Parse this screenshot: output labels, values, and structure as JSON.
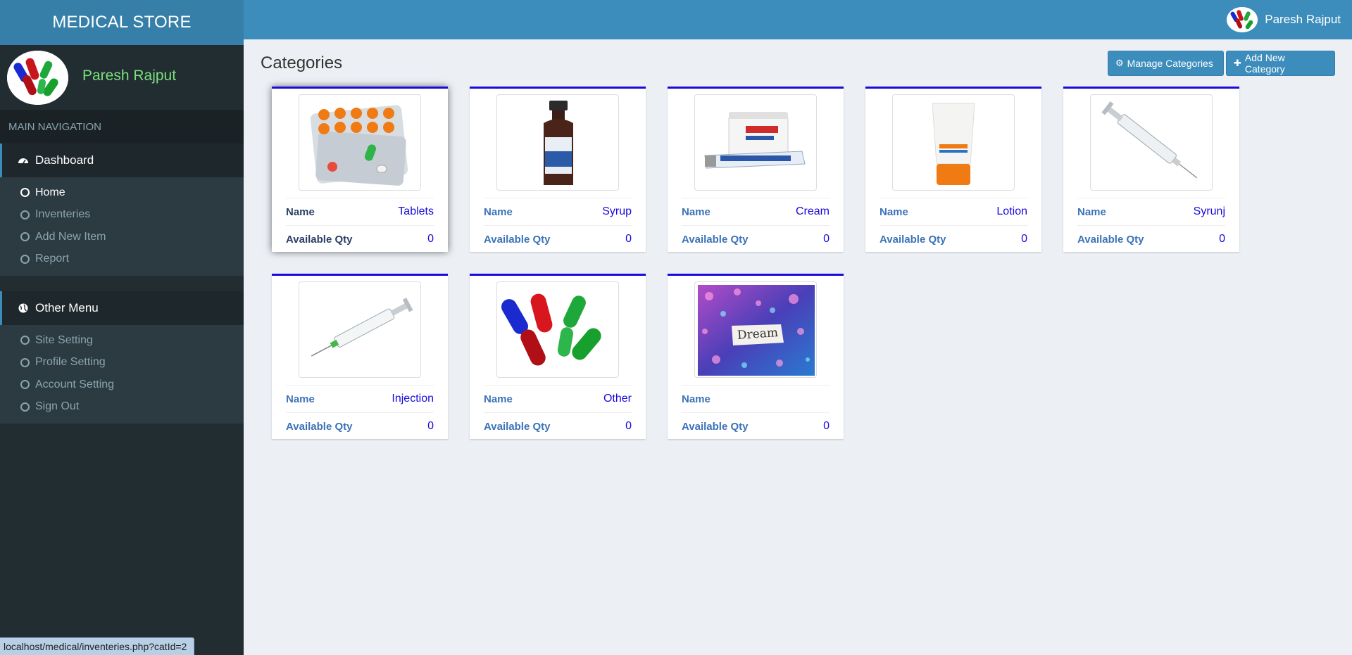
{
  "brand": "MEDICAL STORE",
  "user": {
    "name": "Paresh Rajput"
  },
  "sidebar": {
    "header": "MAIN NAVIGATION",
    "groups": [
      {
        "title": "Dashboard",
        "icon": "dashboard-icon",
        "items": [
          {
            "label": "Home",
            "active": true
          },
          {
            "label": "Inventeries"
          },
          {
            "label": "Add New Item"
          },
          {
            "label": "Report"
          }
        ]
      },
      {
        "title": "Other Menu",
        "icon": "globe-icon",
        "items": [
          {
            "label": "Site Setting"
          },
          {
            "label": "Profile Setting"
          },
          {
            "label": "Account Setting"
          },
          {
            "label": "Sign Out"
          }
        ]
      }
    ]
  },
  "page": {
    "title": "Categories",
    "buttons": {
      "manage": "Manage Categories",
      "add": "Add New Category"
    }
  },
  "card_labels": {
    "name": "Name",
    "qty": "Available Qty"
  },
  "categories": [
    {
      "name": "Tablets",
      "qty": "0",
      "image": "tablets-image"
    },
    {
      "name": "Syrup",
      "qty": "0",
      "image": "syrup-bottle-image"
    },
    {
      "name": "Cream",
      "qty": "0",
      "image": "cream-tube-image"
    },
    {
      "name": "Lotion",
      "qty": "0",
      "image": "lotion-tube-image"
    },
    {
      "name": "Syrunj",
      "qty": "0",
      "image": "syringe-image"
    },
    {
      "name": "Injection",
      "qty": "0",
      "image": "injection-image"
    },
    {
      "name": "Other",
      "qty": "0",
      "image": "capsules-image"
    },
    {
      "name": "",
      "qty": "0",
      "image": "dream-glitter-image"
    }
  ],
  "status_bar": "localhost/medical/inventeries.php?catId=2",
  "colors": {
    "header": "#3c8dbc",
    "brand": "#367fa9",
    "sidebar": "#222d32",
    "card_top": "#1a0adb",
    "label": "#3c73b8",
    "value": "#1a0adb"
  }
}
